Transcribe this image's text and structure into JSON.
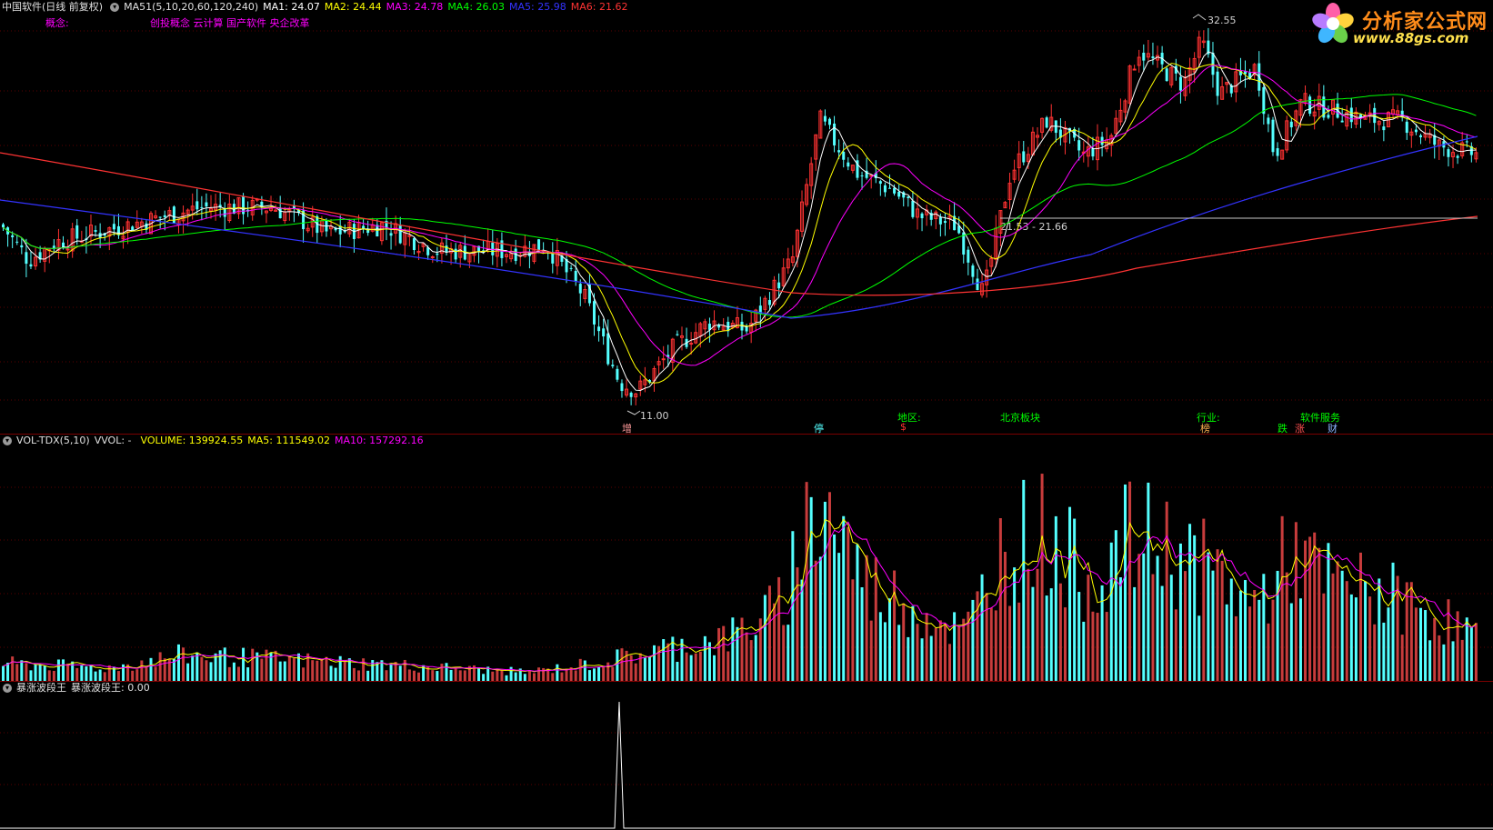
{
  "main_header": {
    "title": "中国软件(日线 前复权)",
    "indicator": "MA51(5,10,20,60,120,240)",
    "ma1": "MA1: 24.07",
    "ma2": "MA2: 24.44",
    "ma3": "MA3: 24.78",
    "ma4": "MA4: 26.03",
    "ma5": "MA5: 25.98",
    "ma6": "MA6: 21.62"
  },
  "concept": {
    "label": "概念:",
    "value": "创投概念 云计算 国产软件 央企改革"
  },
  "price_annotations": {
    "high": "32.55",
    "low": "11.00",
    "level": "21.53 - 21.66"
  },
  "bottom_info": {
    "region_label": "地区:",
    "region_value": "北京板块",
    "industry_label": "行业:",
    "industry_value": "软件服务",
    "markers": [
      "增",
      "停",
      "$",
      "榜",
      "跌",
      "涨",
      "财"
    ]
  },
  "volume_header": {
    "name": "VOL-TDX(5,10)",
    "vvol": "VVOL: -",
    "volume": "VOLUME: 139924.55",
    "ma5": "MA5: 111549.02",
    "ma10": "MA10: 157292.16"
  },
  "indicator_header": {
    "name": "暴涨波段王",
    "value": "暴涨波段王: 0.00"
  },
  "logo": {
    "title": "分析家公式网",
    "url": "www.88gs.com"
  },
  "colors": {
    "up": "#ff3232",
    "down": "#54ffff",
    "ma1": "#ffffff",
    "ma2": "#ffff00",
    "ma3": "#ff00ff",
    "ma4": "#00ff00",
    "ma5": "#3333ff",
    "ma6": "#ff3333"
  }
}
